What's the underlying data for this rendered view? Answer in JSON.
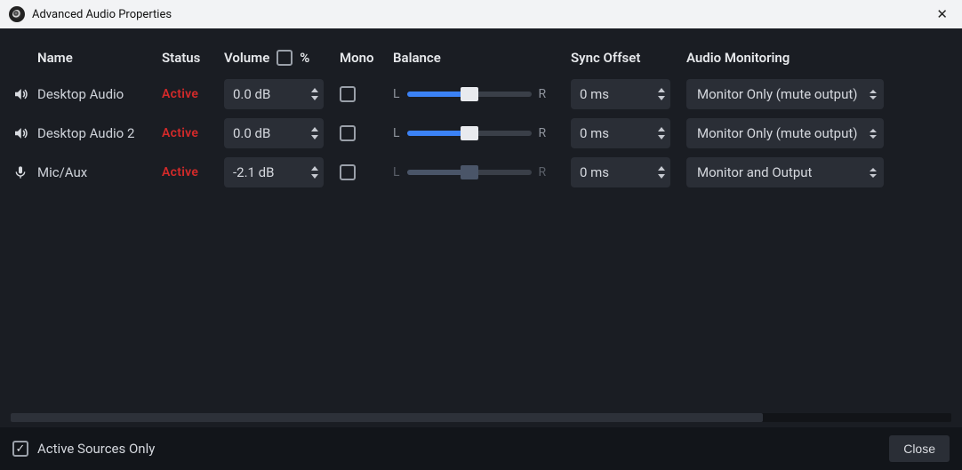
{
  "window": {
    "title": "Advanced Audio Properties"
  },
  "headers": {
    "name": "Name",
    "status": "Status",
    "volume": "Volume",
    "volume_pct": "%",
    "mono": "Mono",
    "balance": "Balance",
    "sync_offset": "Sync Offset",
    "audio_monitoring": "Audio Monitoring"
  },
  "balance_labels": {
    "L": "L",
    "R": "R"
  },
  "rows": [
    {
      "icon": "speaker",
      "name": "Desktop Audio",
      "status": "Active",
      "volume": "0.0 dB",
      "mono": false,
      "balance_pct": 50,
      "balance_muted": false,
      "sync": "0 ms",
      "monitoring": "Monitor Only (mute output)"
    },
    {
      "icon": "speaker",
      "name": "Desktop Audio 2",
      "status": "Active",
      "volume": "0.0 dB",
      "mono": false,
      "balance_pct": 50,
      "balance_muted": false,
      "sync": "0 ms",
      "monitoring": "Monitor Only (mute output)"
    },
    {
      "icon": "mic",
      "name": "Mic/Aux",
      "status": "Active",
      "volume": "-2.1 dB",
      "mono": false,
      "balance_pct": 50,
      "balance_muted": true,
      "sync": "0 ms",
      "monitoring": "Monitor and Output"
    }
  ],
  "footer": {
    "active_only_label": "Active Sources Only",
    "active_only_checked": true,
    "close_label": "Close"
  }
}
